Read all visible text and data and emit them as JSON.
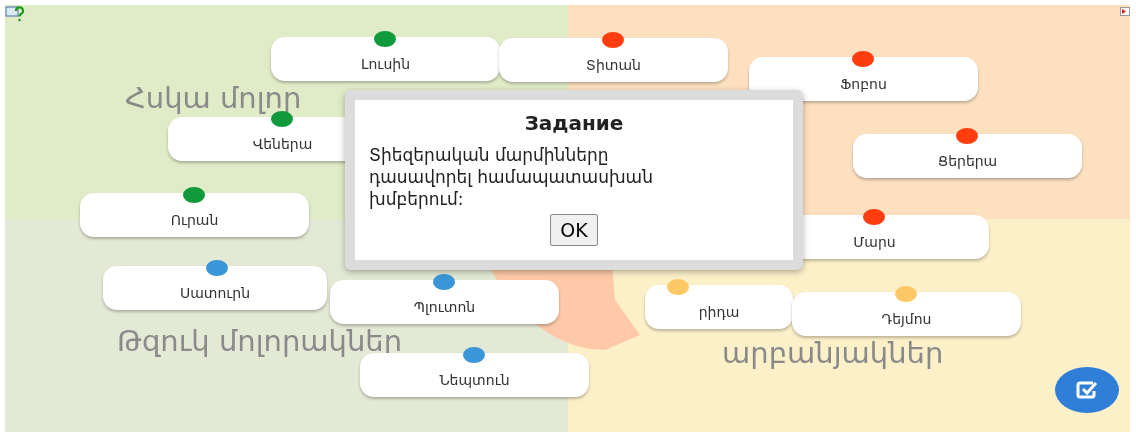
{
  "group_labels": [
    {
      "text": "Հսկա մոլոր"
    },
    {
      "text": "Թզուկ մոլորակներ"
    },
    {
      "text": "արբանյակներ"
    }
  ],
  "cards": [
    {
      "label": "Լուսին",
      "color": "#119a3c"
    },
    {
      "label": "Տիտան",
      "color": "#ff3d0f"
    },
    {
      "label": "Ֆոբոս",
      "color": "#ff3d0f"
    },
    {
      "label": "Վեներա",
      "color": "#119a3c"
    },
    {
      "label": "Ցերերա",
      "color": "#ff3d0f"
    },
    {
      "label": "Ուրան",
      "color": "#119a3c"
    },
    {
      "label": "Մարս",
      "color": "#ff3d0f"
    },
    {
      "label": "Սատուրն",
      "color": "#3a96d8"
    },
    {
      "label": "Պլուտոն",
      "color": "#3a96d8"
    },
    {
      "label": "րիդա",
      "color": "#ffc866"
    },
    {
      "label": "Դեյմոս",
      "color": "#ffc866"
    },
    {
      "label": "Նեպտուն",
      "color": "#3a96d8"
    }
  ],
  "dialog": {
    "title": "Задание",
    "message": "Տիեզերական մարմինները դասավորել համապատասխան խմբերում:",
    "button": "OK"
  }
}
